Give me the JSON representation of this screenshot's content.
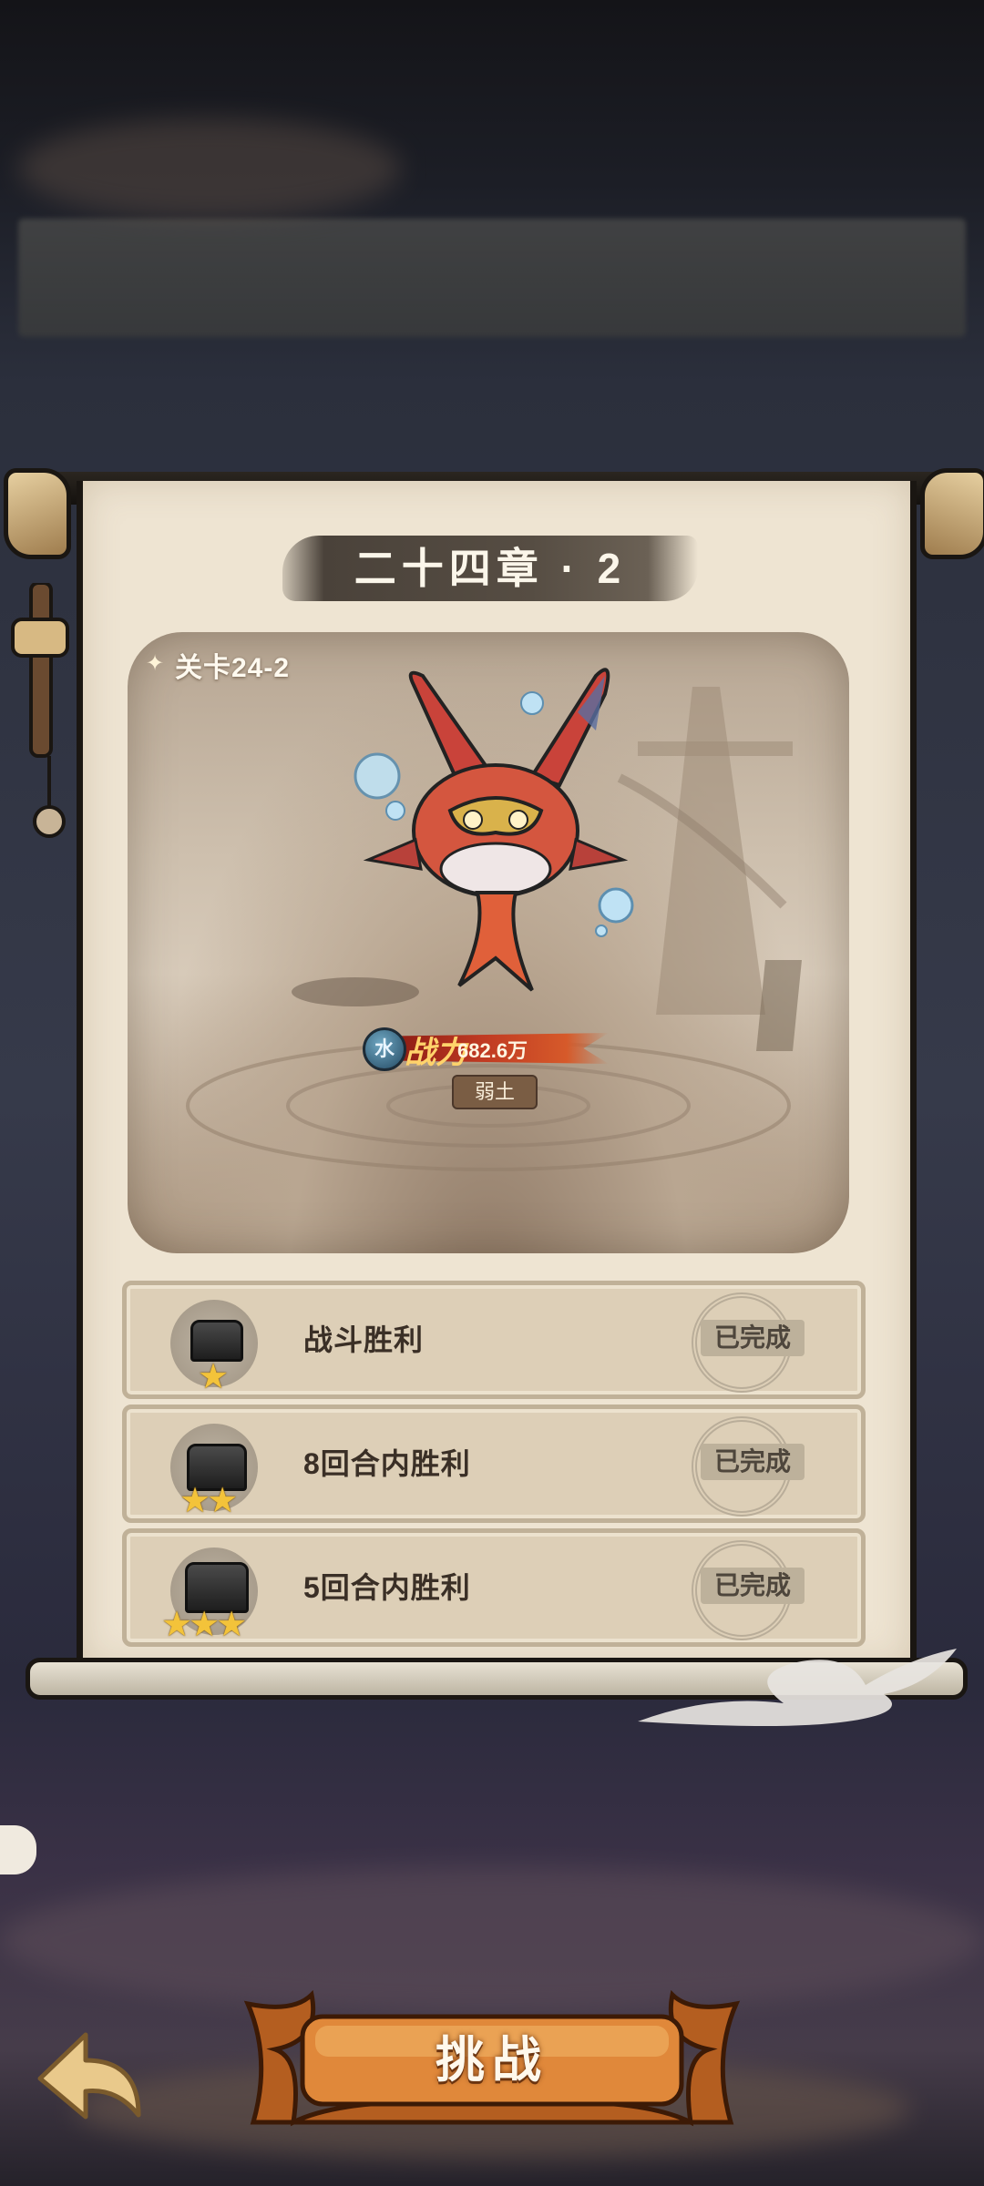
{
  "level": {
    "chapter_title": "二十四章 · 2",
    "stage_label": "关卡24-2",
    "enemy": {
      "element": "水",
      "power_label": "战力",
      "power_value": "682.6万",
      "trait_tag": "弱土"
    }
  },
  "objectives": [
    {
      "text": "战斗胜利",
      "stars": "★",
      "status": "已完成"
    },
    {
      "text": "8回合内胜利",
      "stars": "★★",
      "status": "已完成"
    },
    {
      "text": "5回合内胜利",
      "stars": "★★★",
      "status": "已完成"
    }
  ],
  "actions": {
    "challenge_label": "挑战"
  },
  "colors": {
    "paper": "#eee4d2",
    "star": "#f3c33a",
    "button_orange": "#e0883a",
    "power_red": "#c03a22"
  },
  "icons": {
    "back": "back-arrow-icon",
    "chat": "chat-bubble-icon",
    "element": "water-element-icon",
    "chest": "treasure-chest-icon"
  }
}
